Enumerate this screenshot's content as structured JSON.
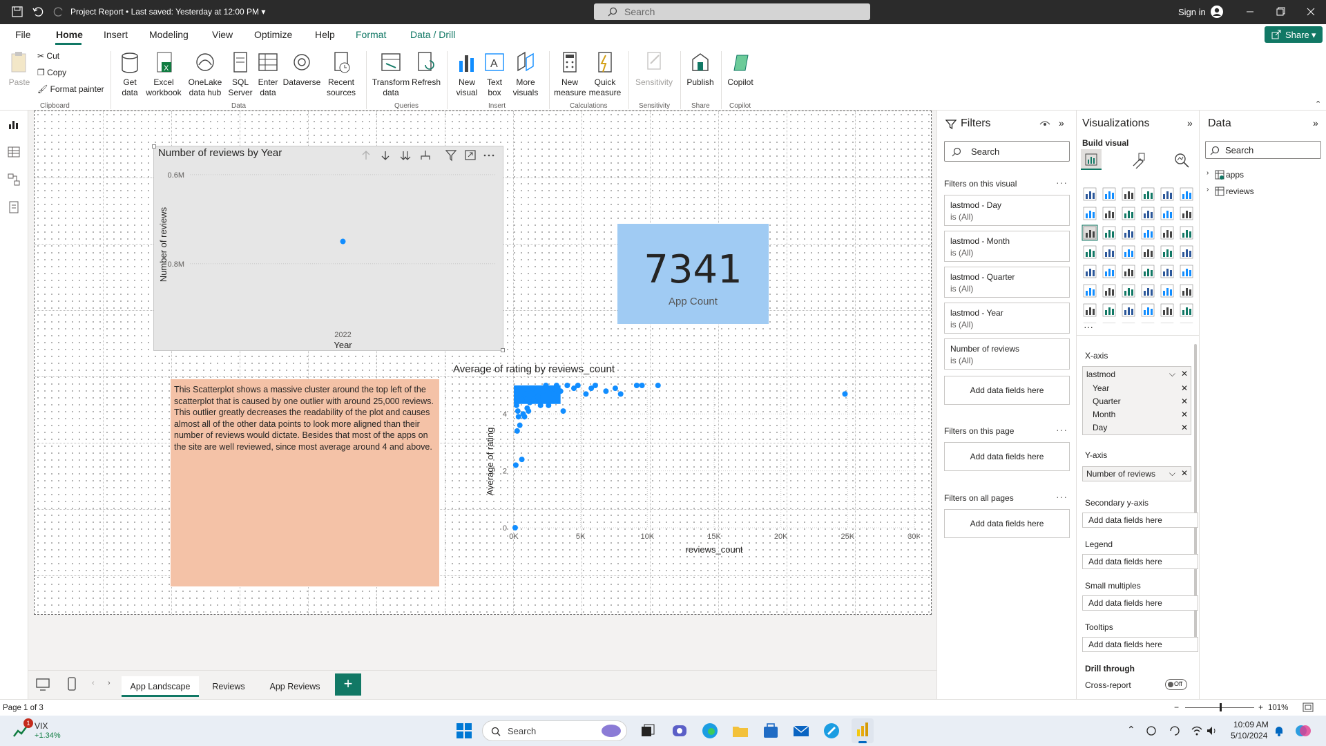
{
  "titlebar": {
    "doc_title": "Project Report",
    "last_saved": "Last saved: Yesterday at 12:00 PM",
    "search_placeholder": "Search",
    "sign_in": "Sign in"
  },
  "menu": {
    "tabs": [
      "File",
      "Home",
      "Insert",
      "Modeling",
      "View",
      "Optimize",
      "Help",
      "Format",
      "Data / Drill"
    ],
    "share": "Share"
  },
  "ribbon": {
    "clipboard": {
      "paste": "Paste",
      "cut": "Cut",
      "copy": "Copy",
      "format_painter": "Format painter",
      "group": "Clipboard"
    },
    "data": {
      "get_data": "Get data",
      "excel": "Excel workbook",
      "onelake": "OneLake data hub",
      "sql": "SQL Server",
      "enter": "Enter data",
      "dataverse": "Dataverse",
      "recent": "Recent sources",
      "group": "Data"
    },
    "queries": {
      "transform": "Transform data",
      "refresh": "Refresh",
      "group": "Queries"
    },
    "insert": {
      "new_visual": "New visual",
      "text_box": "Text box",
      "more_visuals": "More visuals",
      "group": "Insert"
    },
    "calculations": {
      "new_measure": "New measure",
      "quick_measure": "Quick measure",
      "group": "Calculations"
    },
    "sensitivity": {
      "label": "Sensitivity",
      "group": "Sensitivity"
    },
    "share": {
      "publish": "Publish",
      "group": "Share"
    },
    "copilot": {
      "label": "Copilot",
      "group": "Copilot"
    }
  },
  "line_chart": {
    "title": "Number of reviews by Year",
    "y_ticks": [
      "0.8M",
      "0.6M"
    ],
    "x_ticks": [
      "2022"
    ],
    "ylabel": "Number of reviews",
    "xlabel": "Year"
  },
  "card": {
    "value": "7341",
    "label": "App Count"
  },
  "textbox": {
    "text": "This Scatterplot shows a massive cluster around the top left of the scatterplot that is caused by one outlier with around 25,000 reviews. This outlier greatly decreases the readability of the plot and causes almost all of the other data points to look more aligned than their number of reviews would dictate. Besides that most of the apps on the site are well reviewed, since most average around 4 and above."
  },
  "chart_data": [
    {
      "type": "line",
      "title": "Number of reviews by Year",
      "xlabel": "Year",
      "ylabel": "Number of reviews",
      "x": [
        "2022"
      ],
      "values": [
        650000
      ],
      "ylim": [
        550000,
        820000
      ],
      "y_tick_values": [
        600000,
        800000
      ],
      "color": "#118dff"
    },
    {
      "type": "scatter",
      "title": "Average of rating by reviews_count",
      "xlabel": "reviews_count",
      "ylabel": "Average of rating",
      "xlim": [
        0,
        30000
      ],
      "ylim": [
        0,
        5
      ],
      "x_ticks": [
        "0K",
        "5K",
        "10K",
        "15K",
        "20K",
        "25K",
        "30K"
      ],
      "y_ticks": [
        "0",
        "2",
        "4"
      ],
      "color": "#118dff",
      "points": [
        [
          100,
          0
        ],
        [
          150,
          2.2
        ],
        [
          600,
          2.4
        ],
        [
          250,
          3.4
        ],
        [
          450,
          3.6
        ],
        [
          800,
          3.9
        ],
        [
          350,
          3.9
        ],
        [
          2600,
          4.3
        ],
        [
          3700,
          4.1
        ],
        [
          1500,
          4.5
        ],
        [
          1800,
          4.6
        ],
        [
          1200,
          4.4
        ],
        [
          2200,
          4.8
        ],
        [
          2800,
          4.9
        ],
        [
          3200,
          5.0
        ],
        [
          3500,
          4.8
        ],
        [
          4000,
          5.0
        ],
        [
          5400,
          4.7
        ],
        [
          5800,
          4.9
        ],
        [
          6900,
          4.8
        ],
        [
          7600,
          4.9
        ],
        [
          8000,
          4.7
        ],
        [
          9200,
          5.0
        ],
        [
          9600,
          5.0
        ],
        [
          10800,
          5.0
        ],
        [
          24800,
          4.7
        ],
        [
          4500,
          4.9
        ],
        [
          6100,
          5.0
        ],
        [
          4800,
          5.0
        ],
        [
          2000,
          4.3
        ],
        [
          1000,
          4.2
        ],
        [
          700,
          4.0
        ],
        [
          300,
          4.1
        ],
        [
          500,
          4.6
        ],
        [
          900,
          4.7
        ],
        [
          1400,
          4.9
        ],
        [
          1700,
          4.8
        ],
        [
          2400,
          5.0
        ],
        [
          3000,
          4.7
        ],
        [
          600,
          4.5
        ],
        [
          200,
          4.3
        ],
        [
          1100,
          4.1
        ]
      ]
    }
  ],
  "page_tabs": [
    "App Landscape",
    "Reviews",
    "App Reviews"
  ],
  "status": {
    "page": "Page 1 of 3",
    "zoom": "101%"
  },
  "filters": {
    "title": "Filters",
    "search": "Search",
    "on_visual": "Filters on this visual",
    "cards": [
      {
        "name": "lastmod - Day",
        "value": "is (All)"
      },
      {
        "name": "lastmod - Month",
        "value": "is (All)"
      },
      {
        "name": "lastmod - Quarter",
        "value": "is (All)"
      },
      {
        "name": "lastmod - Year",
        "value": "is (All)"
      },
      {
        "name": "Number of reviews",
        "value": "is (All)"
      }
    ],
    "add": "Add data fields here",
    "on_page": "Filters on this page",
    "on_all": "Filters on all pages"
  },
  "viz": {
    "title": "Visualizations",
    "build": "Build visual",
    "xaxis": "X-axis",
    "xfield": "lastmod",
    "xsub": [
      "Year",
      "Quarter",
      "Month",
      "Day"
    ],
    "yaxis": "Y-axis",
    "yfield": "Number of reviews",
    "secondary": "Secondary y-axis",
    "legend": "Legend",
    "small_multiples": "Small multiples",
    "tooltips": "Tooltips",
    "drill": "Drill through",
    "cross": "Cross-report",
    "off": "Off",
    "add": "Add data fields here"
  },
  "data": {
    "title": "Data",
    "search": "Search",
    "tables": [
      "apps",
      "reviews"
    ]
  },
  "taskbar": {
    "stock_name": "VIX",
    "stock_change": "+1.34%",
    "search": "Search",
    "time": "10:09 AM",
    "date": "5/10/2024",
    "badge": "1"
  }
}
